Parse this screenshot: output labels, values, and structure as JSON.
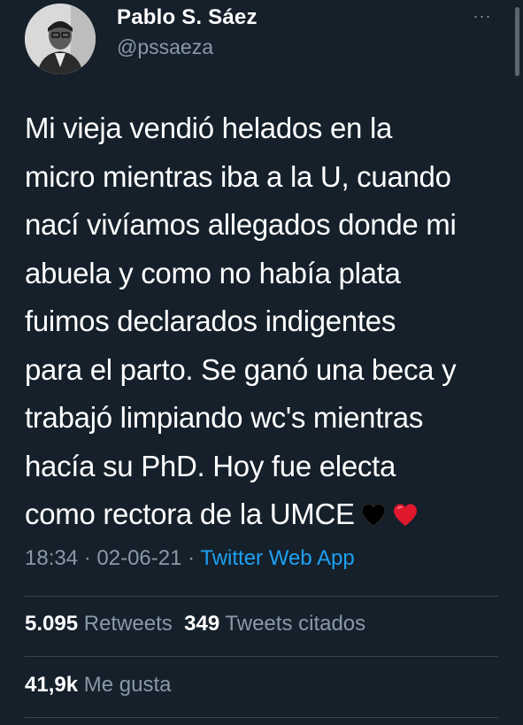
{
  "author": {
    "display_name": "Pablo S. Sáez",
    "handle": "@pssaeza"
  },
  "header": {
    "more_label": "···"
  },
  "tweet": {
    "text": "Mi vieja vendió helados en la\nmicro mientras iba a la U, cuando\nnací vivíamos allegados donde mi\nabuela y como no había plata\nfuimos declarados indigentes\npara el parto. Se ganó una beca y\ntrabajó limpiando wc's mientras\nhacía su PhD. Hoy fue electa\ncomo rectora de la UMCE",
    "emojis": [
      "black-heart-icon",
      "red-heart-icon"
    ],
    "time": "18:34",
    "separator": " · ",
    "date": "02-06-21",
    "source": "Twitter Web App"
  },
  "stats": {
    "retweets_count": "5.095",
    "retweets_label": "Retweets",
    "quotes_count": "349",
    "quotes_label": "Tweets citados",
    "likes_count": "41,9k",
    "likes_label": "Me gusta"
  },
  "colors": {
    "background": "#15202b",
    "text": "#ffffff",
    "secondary": "#8899a6",
    "link": "#1da1f2",
    "divider": "#38444d"
  }
}
